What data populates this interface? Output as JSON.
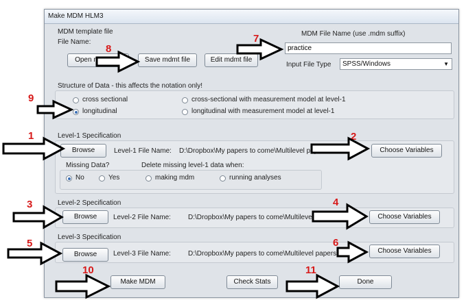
{
  "window": {
    "title": "Make MDM HLM3"
  },
  "template": {
    "section_label": "MDM template file",
    "file_name_label": "File Name:",
    "open_button": "Open mdmt file",
    "save_button": "Save mdmt file",
    "edit_button": "Edit mdmt file"
  },
  "mdm_file": {
    "label": "MDM File Name (use .mdm suffix)",
    "value": "practice",
    "input_type_label": "Input File Type",
    "input_type_value": "SPSS/Windows"
  },
  "structure": {
    "label": "Structure of Data - this affects the notation only!",
    "options": [
      {
        "label": "cross sectional",
        "selected": false
      },
      {
        "label": "longitudinal",
        "selected": true
      },
      {
        "label": "cross-sectional with measurement model at level-1",
        "selected": false
      },
      {
        "label": "longitudinal with measurement model at level-1",
        "selected": false
      }
    ]
  },
  "level1": {
    "label": "Level-1 Specification",
    "browse": "Browse",
    "file_label": "Level-1 File Name:",
    "file_path": "D:\\Dropbox\\My papers to come\\Multilevel papers\\",
    "choose": "Choose Variables",
    "missing_label": "Missing Data?",
    "missing_no": "No",
    "missing_yes": "Yes",
    "delete_label": "Delete missing level-1 data when:",
    "delete_making": "making mdm",
    "delete_running": "running analyses"
  },
  "level2": {
    "label": "Level-2 Specification",
    "browse": "Browse",
    "file_label": "Level-2 File Name:",
    "file_path": "D:\\Dropbox\\My papers to come\\Multilevel papers\\",
    "choose": "Choose Variables"
  },
  "level3": {
    "label": "Level-3 Specification",
    "browse": "Browse",
    "file_label": "Level-3 File Name:",
    "file_path": "D:\\Dropbox\\My papers to come\\Multilevel papers\\",
    "choose": "Choose Variables"
  },
  "footer": {
    "make_mdm": "Make MDM",
    "check_stats": "Check Stats",
    "done": "Done"
  },
  "annotations": [
    "1",
    "2",
    "3",
    "4",
    "5",
    "6",
    "7",
    "8",
    "9",
    "10",
    "11"
  ],
  "colors": {
    "annotation_number": "#d71919",
    "arrow_fill": "#ffffff",
    "arrow_stroke": "#000000",
    "selected_radio": "#3b6fb6"
  }
}
